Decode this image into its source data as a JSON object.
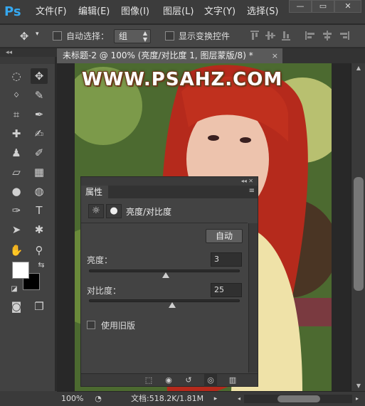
{
  "app": {
    "logo_text": "Ps",
    "menus": [
      "文件(F)",
      "编辑(E)",
      "图像(I)",
      "图层(L)",
      "文字(Y)",
      "选择(S)"
    ],
    "window_controls": [
      "—",
      "▭",
      "✕"
    ]
  },
  "options_bar": {
    "auto_select_label": "自动选择：",
    "auto_select_value": "组",
    "show_transform_label": "显示变换控件"
  },
  "panel_collapse_glyph": "◂◂",
  "document": {
    "tab_title": "未标题-2 @ 100% (亮度/对比度 1, 图层蒙版/8) *",
    "tab_close": "×",
    "watermark": "WWW.PSAHZ.COM"
  },
  "tools": [
    {
      "name": "marquee-tool",
      "glyph": "◌"
    },
    {
      "name": "move-tool",
      "glyph": "✥"
    },
    {
      "name": "lasso-tool",
      "glyph": "ᛜ"
    },
    {
      "name": "quick-select-tool",
      "glyph": "✎"
    },
    {
      "name": "crop-tool",
      "glyph": "⌗"
    },
    {
      "name": "eyedropper-tool",
      "glyph": "✒"
    },
    {
      "name": "healing-brush-tool",
      "glyph": "✚"
    },
    {
      "name": "brush-tool",
      "glyph": "✍"
    },
    {
      "name": "clone-stamp-tool",
      "glyph": "♟"
    },
    {
      "name": "history-brush-tool",
      "glyph": "✐"
    },
    {
      "name": "eraser-tool",
      "glyph": "▱"
    },
    {
      "name": "gradient-tool",
      "glyph": "▦"
    },
    {
      "name": "blur-tool",
      "glyph": "●"
    },
    {
      "name": "dodge-tool",
      "glyph": "◍"
    },
    {
      "name": "pen-tool",
      "glyph": "✑"
    },
    {
      "name": "type-tool",
      "glyph": "T"
    },
    {
      "name": "path-selection-tool",
      "glyph": "➤"
    },
    {
      "name": "custom-shape-tool",
      "glyph": "✱"
    },
    {
      "name": "hand-tool",
      "glyph": "✋"
    },
    {
      "name": "zoom-tool",
      "glyph": "⚲"
    }
  ],
  "colors": {
    "foreground": "#ffffff",
    "background": "#000000",
    "ps_blue": "#35a8f0"
  },
  "properties": {
    "tab": "属性",
    "collapse": "◂◂ ✕",
    "menu_glyph": "≡",
    "adjustment_title": "亮度/对比度",
    "auto_button": "自动",
    "brightness_label": "亮度：",
    "brightness_value": "3",
    "contrast_label": "对比度：",
    "contrast_value": "25",
    "legacy_label": "使用旧版",
    "sliders": {
      "brightness_fraction": 0.51,
      "contrast_fraction": 0.55
    }
  },
  "status": {
    "zoom": "100%",
    "doc": "文档:518.2K/1.81M"
  }
}
